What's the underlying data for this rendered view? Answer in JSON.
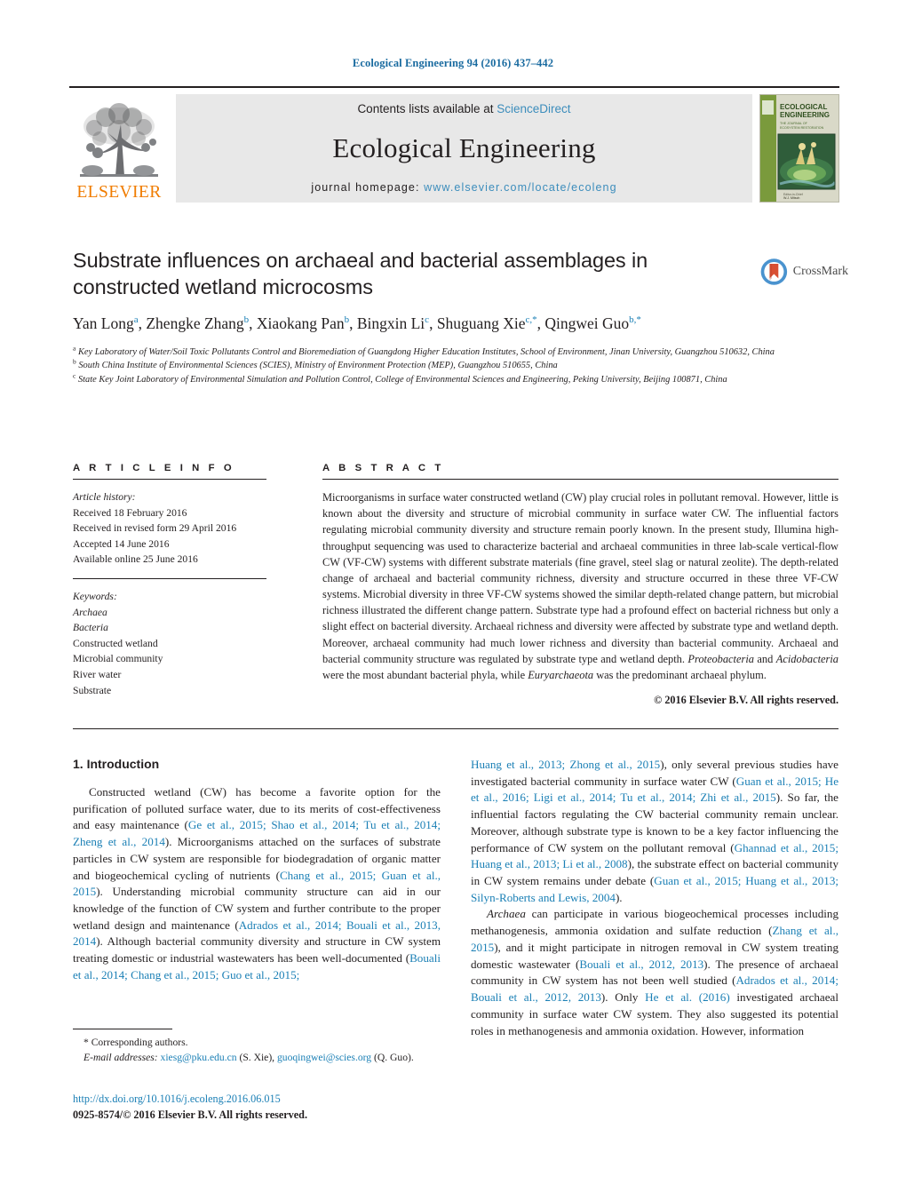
{
  "running_head": "Ecological Engineering 94 (2016) 437–442",
  "masthead": {
    "contents_prefix": "Contents lists available at ",
    "sciencedirect": "ScienceDirect",
    "journal_name": "Ecological Engineering",
    "homepage_prefix": "journal homepage: ",
    "homepage_url": "www.elsevier.com/locate/ecoleng",
    "publisher_wordmark": "ELSEVIER",
    "cover_title_line1": "ECOLOGICAL",
    "cover_title_line2": "ENGINEERING"
  },
  "crossmark": {
    "label": "CrossMark"
  },
  "article": {
    "title": "Substrate influences on archaeal and bacterial assemblages in constructed wetland microcosms",
    "authors_html": "Yan Long<sup>a</sup>, Zhengke Zhang<sup>b</sup>, Xiaokang Pan<sup>b</sup>, Bingxin Li<sup>c</sup>, Shuguang Xie<sup>c,</sup><sup>*</sup>, Qingwei Guo<sup>b,</sup><sup>*</sup>",
    "affiliations": [
      {
        "marker": "a",
        "text": "Key Laboratory of Water/Soil Toxic Pollutants Control and Bioremediation of Guangdong Higher Education Institutes, School of Environment, Jinan University, Guangzhou 510632, China"
      },
      {
        "marker": "b",
        "text": "South China Institute of Environmental Sciences (SCIES), Ministry of Environment Protection (MEP), Guangzhou 510655, China"
      },
      {
        "marker": "c",
        "text": "State Key Joint Laboratory of Environmental Simulation and Pollution Control, College of Environmental Sciences and Engineering, Peking University, Beijing 100871, China"
      }
    ]
  },
  "article_info": {
    "heading": "A R T I C L E   I N F O",
    "history_label": "Article history:",
    "history": [
      "Received 18 February 2016",
      "Received in revised form 29 April 2016",
      "Accepted 14 June 2016",
      "Available online 25 June 2016"
    ],
    "keywords_label": "Keywords:",
    "keywords": [
      "Archaea",
      "Bacteria",
      "Constructed wetland",
      "Microbial community",
      "River water",
      "Substrate"
    ],
    "keywords_italic": [
      true,
      true,
      false,
      false,
      false,
      false
    ]
  },
  "abstract": {
    "heading": "A B S T R A C T",
    "text_html": "Microorganisms in surface water constructed wetland (CW) play crucial roles in pollutant removal. However, little is known about the diversity and structure of microbial community in surface water CW. The influential factors regulating microbial community diversity and structure remain poorly known. In the present study, Illumina high-throughput sequencing was used to characterize bacterial and archaeal communities in three lab-scale vertical-flow CW (VF-CW) systems with different substrate materials (fine gravel, steel slag or natural zeolite). The depth-related change of archaeal and bacterial community richness, diversity and structure occurred in these three VF-CW systems. Microbial diversity in three VF-CW systems showed the similar depth-related change pattern, but microbial richness illustrated the different change pattern. Substrate type had a profound effect on bacterial richness but only a slight effect on bacterial diversity. Archaeal richness and diversity were affected by substrate type and wetland depth. Moreover, archaeal community had much lower richness and diversity than bacterial community. Archaeal and bacterial community structure was regulated by substrate type and wetland depth. <i>Proteobacteria</i> and <i>Acidobacteria</i> were the most abundant bacterial phyla, while <i>Euryarchaeota</i> was the predominant archaeal phylum.",
    "copyright": "© 2016 Elsevier B.V. All rights reserved."
  },
  "body": {
    "section_heading": "1.  Introduction",
    "left_paragraph_html": "Constructed wetland (CW) has become a favorite option for the purification of polluted surface water, due to its merits of cost-effectiveness and easy maintenance (<span class=\"cite\">Ge et al., 2015; Shao et al., 2014; Tu et al., 2014; Zheng et al., 2014</span>). Microorganisms attached on the surfaces of substrate particles in CW system are responsible for biodegradation of organic matter and biogeochemical cycling of nutrients (<span class=\"cite\">Chang et al., 2015; Guan et al., 2015</span>). Understanding microbial community structure can aid in our knowledge of the function of CW system and further contribute to the proper wetland design and maintenance (<span class=\"cite\">Adrados et al., 2014; Bouali et al., 2013, 2014</span>). Although bacterial community diversity and structure in CW system treating domestic or industrial wastewaters has been well-documented (<span class=\"cite\">Bouali et al., 2014; Chang et al., 2015; Guo et al., 2015;</span>",
    "right_paragraph1_html": "<span class=\"cite\">Huang et al., 2013; Zhong et al., 2015</span>), only several previous studies have investigated bacterial community in surface water CW (<span class=\"cite\">Guan et al., 2015; He et al., 2016; Ligi et al., 2014; Tu et al., 2014; Zhi et al., 2015</span>). So far, the influential factors regulating the CW bacterial community remain unclear. Moreover, although substrate type is known to be a key factor influencing the performance of CW system on the pollutant removal (<span class=\"cite\">Ghannad et al., 2015; Huang et al., 2013; Li et al., 2008</span>), the substrate effect on bacterial community in CW system remains under debate (<span class=\"cite\">Guan et al., 2015; Huang et al., 2013; Silyn-Roberts and Lewis, 2004</span>).",
    "right_paragraph2_html": "<i>Archaea</i> can participate in various biogeochemical processes including methanogenesis, ammonia oxidation and sulfate reduction (<span class=\"cite\">Zhang et al., 2015</span>), and it might participate in nitrogen removal in CW system treating domestic wastewater (<span class=\"cite\">Bouali et al., 2012, 2013</span>). The presence of archaeal community in CW system has not been well studied (<span class=\"cite\">Adrados et al., 2014; Bouali et al., 2012, 2013</span>). Only <span class=\"cite\">He et al. (2016)</span> investigated archaeal community in surface water CW system. They also suggested its potential roles in methanogenesis and ammonia oxidation. However, information"
  },
  "footnote": {
    "corresponding_marker": "*",
    "corresponding_text": "Corresponding authors.",
    "email_label": "E-mail addresses:",
    "email1": "xiesg@pku.edu.cn",
    "email1_owner": "(S. Xie),",
    "email2": "guoqingwei@scies.org",
    "email2_owner": "(Q. Guo)."
  },
  "publication_footer": {
    "doi": "http://dx.doi.org/10.1016/j.ecoleng.2016.06.015",
    "issn_line": "0925-8574/© 2016 Elsevier B.V. All rights reserved."
  },
  "colors": {
    "link_blue": "#1a7fb5",
    "elsevier_orange": "#f07c00",
    "band_gray": "#e8e8e8",
    "text_black": "#231f20"
  }
}
